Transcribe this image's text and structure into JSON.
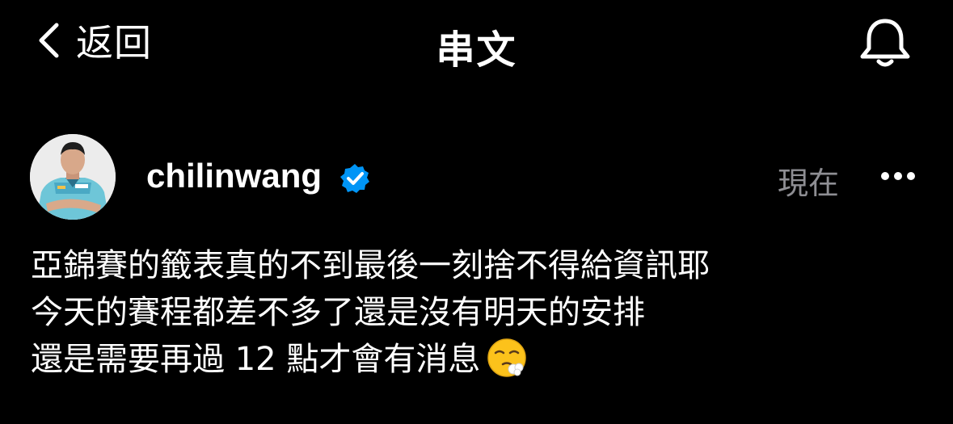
{
  "header": {
    "back_label": "返回",
    "title": "串文",
    "back_icon": "chevron-left-icon",
    "notification_icon": "bell-icon"
  },
  "post": {
    "username": "chilinwang",
    "verified": true,
    "timestamp": "現在",
    "more_icon": "ellipsis-icon",
    "lines": [
      "亞錦賽的籤表真的不到最後一刻捨不得給資訊耶",
      "今天的賽程都差不多了還是沒有明天的安排",
      "還是需要再過 12 點才會有消息"
    ],
    "emoji": "face-exhaling-emoji"
  },
  "colors": {
    "background": "#000000",
    "text": "#ffffff",
    "muted": "#8e8e93",
    "verified": "#0095f6"
  }
}
